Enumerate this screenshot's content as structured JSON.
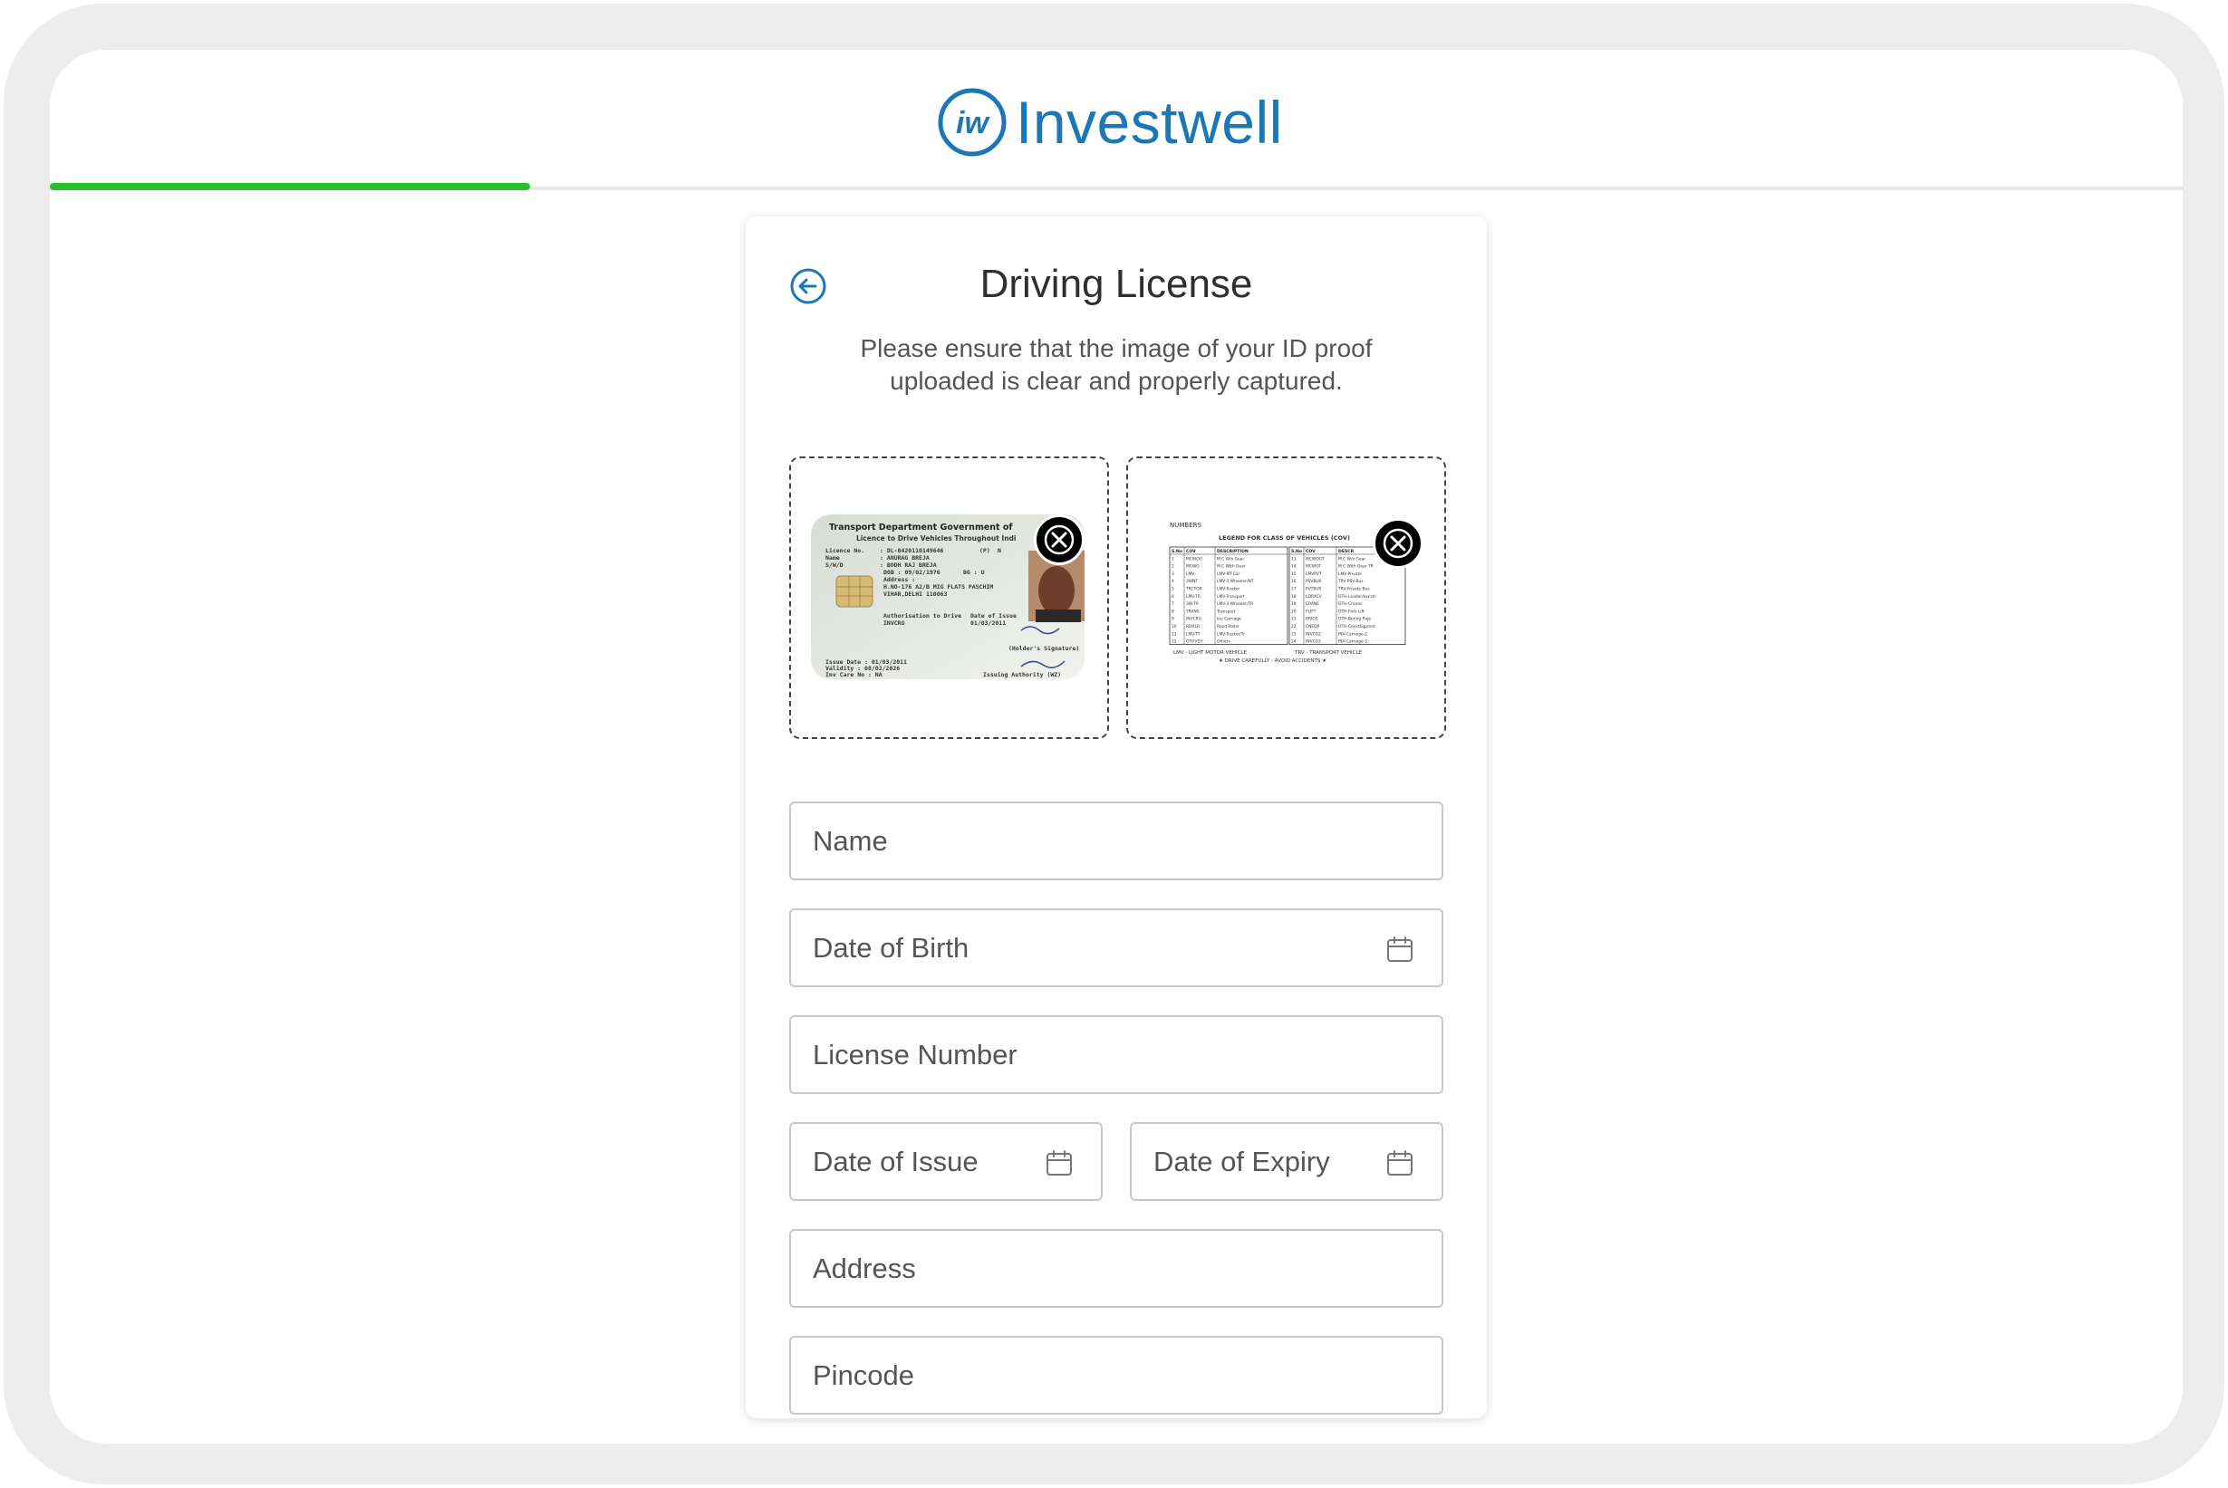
{
  "brand": {
    "name": "Investwell",
    "color": "#1b77b6"
  },
  "progress": {
    "fraction": 0.225,
    "color": "#26c22a"
  },
  "page": {
    "title": "Driving License",
    "subtitle": "Please ensure that the image of your ID proof uploaded is clear and properly captured.",
    "back_icon": "arrow-left-circle-icon"
  },
  "uploads": {
    "front": {
      "header_line1": "Transport Department Government of",
      "header_line2": "Licence to Drive Vehicles Throughout Indi",
      "licence_no_label": "Licence No.",
      "licence_no": ": DL-0420110149646",
      "p_marker": "(P)",
      "n_marker": "N",
      "name_label": "Name",
      "name_value": ": ANURAG BREJA",
      "swd_label": "S/W/D",
      "swd_value": ": BODH RAJ BREJA",
      "dob": "DOB : 09/02/1976",
      "bg": "BG : U",
      "address_label": "Address :",
      "address_line1": "H.NO-176 A2/B MIG FLATS PASCHIM",
      "address_line2": "VIHAR,DELHI 110063",
      "auth_label": "Authorisation to Drive",
      "auth_value": "INVCRG",
      "doi_label": "Date of Issue",
      "doi_value": "01/03/2011",
      "holder_sig": "(Holder's Signature)",
      "issue_date": "Issue Date : 01/03/2011",
      "validity": "Validity : 08/02/2026",
      "inv_care": "Inv Care No : NA",
      "issuing_authority": "Issuing Authority (WZ)",
      "remove_icon": "close-icon"
    },
    "back": {
      "numbers_label": "NUMBERS",
      "legend_title": "LEGEND FOR CLASS OF VEHICLES (COV)",
      "col_headers": [
        "S.No",
        "COV",
        "DESCRIPTION",
        "S.No",
        "COV",
        "DESCR"
      ],
      "left_rows": [
        [
          "1",
          "MCWOG",
          "M.C W/o Gear"
        ],
        [
          "2",
          "MCWG",
          "M.C With Gear"
        ],
        [
          "3",
          "LMV",
          "LMV-NT-Car"
        ],
        [
          "4",
          "3WNT",
          "LMV-3 Wheeler/NT"
        ],
        [
          "5",
          "TRCTOR",
          "LMV-Tractor"
        ],
        [
          "6",
          "LMV-TR",
          "LMV-Transport"
        ],
        [
          "7",
          "3W-TR",
          "LMV-3 Wheeler/TR"
        ],
        [
          "8",
          "TRANS",
          "Transport"
        ],
        [
          "9",
          "INVCRG",
          "Inv Carriage"
        ],
        [
          "10",
          "RDRLR",
          "Road Roller"
        ],
        [
          "11",
          "LMV-TT",
          "LMV-Tractor/Tr"
        ],
        [
          "12",
          "OTHVEH",
          "Others"
        ]
      ],
      "right_rows": [
        [
          "13",
          "MCWOGT",
          "M.C W/o Gear"
        ],
        [
          "14",
          "MCWGT",
          "M.C With Gear TR"
        ],
        [
          "15",
          "LMVPVT",
          "LMV-Private"
        ],
        [
          "16",
          "PSVBUS",
          "TRV-PSV-Bus"
        ],
        [
          "17",
          "PVTBUS",
          "TRV-Private Bus"
        ],
        [
          "18",
          "LDRXCV",
          "OTH-Loader/excvtr"
        ],
        [
          "19",
          "CRANE",
          "OTH-Cranes"
        ],
        [
          "20",
          "FLIFT",
          "OTH-Fork Lift"
        ],
        [
          "21",
          "BRIGS",
          "OTH-Boring Rigs"
        ],
        [
          "22",
          "CNEQP",
          "OTH-ConstEqpmnt"
        ],
        [
          "23",
          "INVCG2",
          "INV-Carriage-2"
        ],
        [
          "24",
          "INVCG3",
          "INV-Carriage-3"
        ]
      ],
      "footer_left": "LMV - LIGHT MOTOR VEHICLE",
      "footer_right": "TRV - TRANSPORT VEHICLE",
      "footer_motto": "★ DRIVE CAREFULLY - AVOID ACCIDENTS ★",
      "remove_icon": "close-icon"
    }
  },
  "form": {
    "name": {
      "placeholder": "Name",
      "value": ""
    },
    "dob": {
      "placeholder": "Date of Birth",
      "value": "",
      "icon": "calendar-icon"
    },
    "license_number": {
      "placeholder": "License Number",
      "value": ""
    },
    "date_of_issue": {
      "placeholder": "Date of Issue",
      "value": "",
      "icon": "calendar-icon"
    },
    "date_of_expiry": {
      "placeholder": "Date of Expiry",
      "value": "",
      "icon": "calendar-icon"
    },
    "address": {
      "placeholder": "Address",
      "value": ""
    },
    "pincode": {
      "placeholder": "Pincode",
      "value": ""
    }
  }
}
